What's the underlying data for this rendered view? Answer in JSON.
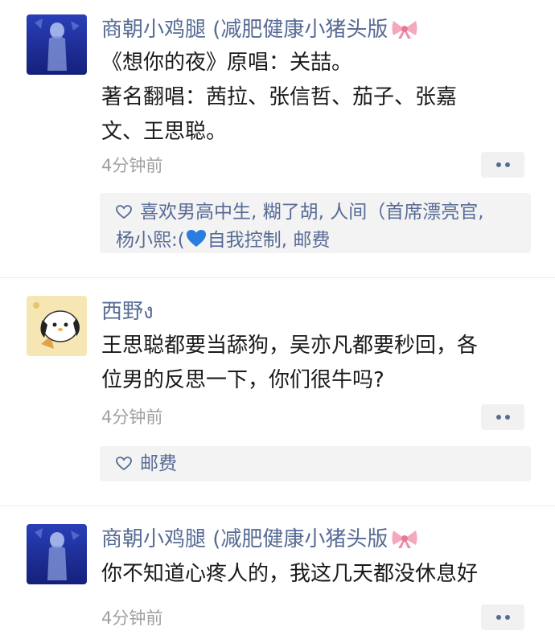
{
  "posts": [
    {
      "author": "商朝小鸡腿 (减肥健康小猪头版",
      "author_emoji": "ribbon-bow",
      "lines": [
        "《想你的夜》原唱：关喆。",
        "著名翻唱：茜拉、张信哲、茄子、张嘉",
        "文、王思聪。"
      ],
      "time": "4分钟前",
      "likes": {
        "line1": "喜欢男高中生, 糊了胡, 人间（首席漂亮官,",
        "line2_before": "杨小熙:(",
        "line2_emoji": "blue-heart",
        "line2_after": "自我控制, 邮费"
      }
    },
    {
      "author": "西野ง",
      "lines": [
        "王思聪都要当舔狗，吴亦凡都要秒回，各",
        "位男的反思一下，你们很牛吗?"
      ],
      "time": "4分钟前",
      "likes": {
        "line1": "邮费"
      }
    },
    {
      "author": "商朝小鸡腿 (减肥健康小猪头版",
      "author_emoji": "ribbon-bow",
      "lines": [
        "你不知道心疼人的，我这几天都没休息好"
      ],
      "time": "4分钟前"
    }
  ],
  "colors": {
    "name": "#576b95",
    "timestamp": "#a0a0a0",
    "like_box": "#f3f3f3",
    "background": "#ffffff"
  }
}
